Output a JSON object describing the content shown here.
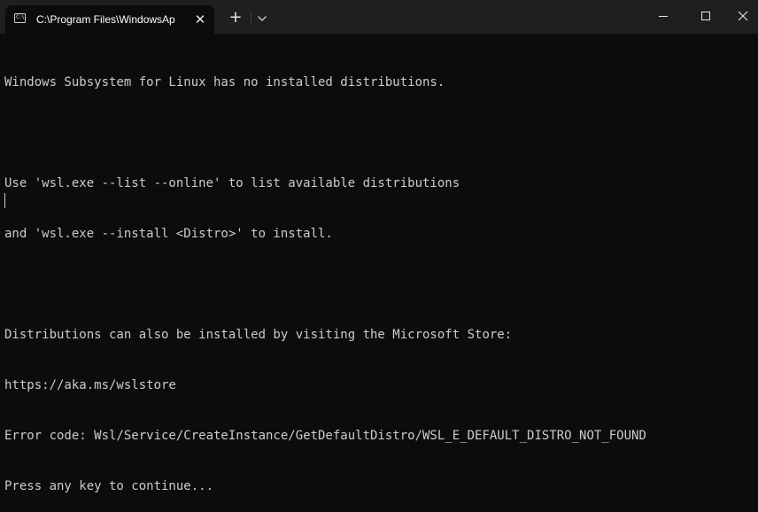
{
  "window": {
    "tab_title": "C:\\Program Files\\WindowsAp",
    "tab_icon": "terminal-prompt-icon",
    "tab_icon_glyph": "C:\\",
    "close_tab_glyph": "✕",
    "new_tab_glyph": "+",
    "controls": [
      "minimize-icon",
      "maximize-icon",
      "close-icon"
    ]
  },
  "console": {
    "lines": [
      "Windows Subsystem for Linux has no installed distributions.",
      "",
      "Use 'wsl.exe --list --online' to list available distributions",
      "and 'wsl.exe --install <Distro>' to install.",
      "",
      "Distributions can also be installed by visiting the Microsoft Store:",
      "https://aka.ms/wslstore",
      "Error code: Wsl/Service/CreateInstance/GetDefaultDistro/WSL_E_DEFAULT_DISTRO_NOT_FOUND",
      "Press any key to continue..."
    ]
  },
  "colors": {
    "background": "#0c0c0c",
    "titlebar": "#1f1f1f",
    "text": "#cccccc"
  }
}
